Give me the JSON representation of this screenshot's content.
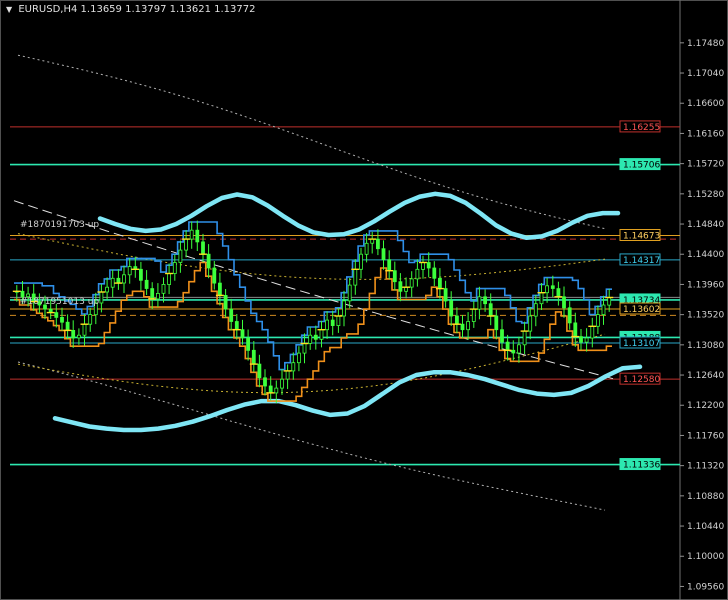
{
  "window": {
    "symbol": "EURUSD,H4",
    "ohlc": "1.13659 1.13797 1.13621 1.13772"
  },
  "objects": {
    "label_1": "#1870191703",
    "label_1_suffix": "up",
    "label_2": "#1871951013",
    "label_2_suffix": "up"
  },
  "chart_data": {
    "type": "candlestick",
    "symbol": "EURUSD",
    "timeframe": "H4",
    "ylim": [
      1.0945,
      1.179
    ],
    "y_ticks": [
      1.1748,
      1.1704,
      1.166,
      1.1616,
      1.1572,
      1.1528,
      1.1484,
      1.144,
      1.1396,
      1.1352,
      1.1308,
      1.1264,
      1.122,
      1.1176,
      1.1132,
      1.1088,
      1.1044,
      1.1,
      1.0956
    ],
    "y_tick_labels": [
      "1.17480",
      "1.17040",
      "1.16600",
      "1.16160",
      "1.15720",
      "1.15280",
      "1.14840",
      "1.14400",
      "1.13960",
      "1.13520",
      "1.13080",
      "1.12640",
      "1.12200",
      "1.11760",
      "1.11320",
      "1.10880",
      "1.10440",
      "1.10000",
      "1.09560"
    ],
    "horizontal_levels": [
      {
        "price": 1.16255,
        "label": "1.16255",
        "color": "#c0302c",
        "label_bg": "#000000",
        "label_border": "#c0302c",
        "label_color": "#ff5555"
      },
      {
        "price": 1.15706,
        "label": "1.15706",
        "color": "#2de8b0",
        "label_bg": "#2de8b0",
        "label_color": "#000000"
      },
      {
        "price": 1.14673,
        "label": "1.14673",
        "color": "#e0a020",
        "label_bg": "#000000",
        "label_border": "#e0a020",
        "label_color": "#ffd060"
      },
      {
        "price": 1.14317,
        "label": "1.14317",
        "color": "#2aa8c8",
        "label_bg": "#000000",
        "label_border": "#2aa8c8",
        "label_color": "#40d0f0"
      },
      {
        "price": 1.13772,
        "label": "1.13772",
        "color": "#8a8a8a",
        "label_bg": "#000000",
        "label_color": "#9a9a9a"
      },
      {
        "price": 1.13734,
        "label": "1.13734",
        "color": "#2de8b0",
        "label_bg": "#2de8b0",
        "label_color": "#000000"
      },
      {
        "price": 1.13602,
        "label": "1.13602",
        "color": "#e0a020",
        "label_bg": "#000000",
        "label_border": "#e0a020",
        "label_color": "#ffd060"
      },
      {
        "price": 1.13188,
        "label": "1.13188",
        "color": "#2de8b0",
        "label_bg": "#2de8b0",
        "label_color": "#000000"
      },
      {
        "price": 1.13107,
        "label": "1.13107",
        "color": "#2aa8c8",
        "label_bg": "#000000",
        "label_border": "#2aa8c8",
        "label_color": "#40d0f0"
      },
      {
        "price": 1.1258,
        "label": "1.12580",
        "color": "#c0302c",
        "label_bg": "#000000",
        "label_border": "#c0302c",
        "label_color": "#ff5555"
      },
      {
        "price": 1.11336,
        "label": "1.11336",
        "color": "#2de8b0",
        "label_bg": "#2de8b0",
        "label_color": "#000000"
      }
    ],
    "dashed_levels": [
      {
        "price": 1.1462,
        "color": "#c0302c"
      },
      {
        "price": 1.1351,
        "color": "#d08a20"
      }
    ],
    "close_series": [
      1.1386,
      1.1378,
      1.1382,
      1.1371,
      1.1366,
      1.136,
      1.1355,
      1.1348,
      1.1341,
      1.1329,
      1.1318,
      1.1322,
      1.1338,
      1.1352,
      1.1369,
      1.1385,
      1.1392,
      1.1405,
      1.1398,
      1.141,
      1.1422,
      1.1418,
      1.1402,
      1.139,
      1.1375,
      1.1383,
      1.1396,
      1.1412,
      1.1428,
      1.1446,
      1.1462,
      1.1475,
      1.1458,
      1.144,
      1.142,
      1.1398,
      1.138,
      1.136,
      1.1342,
      1.133,
      1.1318,
      1.13,
      1.128,
      1.126,
      1.1248,
      1.1238,
      1.1245,
      1.1258,
      1.127,
      1.1282,
      1.1296,
      1.131,
      1.1322,
      1.1316,
      1.133,
      1.1344,
      1.1336,
      1.135,
      1.1372,
      1.1395,
      1.1418,
      1.144,
      1.1456,
      1.1462,
      1.1448,
      1.1432,
      1.1416,
      1.14,
      1.1386,
      1.1392,
      1.1404,
      1.1418,
      1.1428,
      1.142,
      1.1405,
      1.139,
      1.1372,
      1.135,
      1.1338,
      1.133,
      1.1342,
      1.136,
      1.1378,
      1.1368,
      1.135,
      1.133,
      1.1312,
      1.13,
      1.1296,
      1.1308,
      1.1328,
      1.135,
      1.1368,
      1.1384,
      1.1394,
      1.139,
      1.1378,
      1.1362,
      1.134,
      1.132,
      1.1312,
      1.1318,
      1.1335,
      1.1352,
      1.1366,
      1.1377
    ],
    "upper_envelope": [
      1.1492,
      1.1484,
      1.1477,
      1.1474,
      1.1476,
      1.1484,
      1.1496,
      1.151,
      1.1522,
      1.1527,
      1.1523,
      1.1511,
      1.1496,
      1.1482,
      1.1472,
      1.1468,
      1.1469,
      1.1476,
      1.1488,
      1.1502,
      1.1515,
      1.1524,
      1.1528,
      1.1525,
      1.1515,
      1.1499,
      1.1482,
      1.147,
      1.1464,
      1.1466,
      1.1474,
      1.1486,
      1.1496,
      1.15,
      1.15
    ],
    "lower_envelope": [
      1.1201,
      1.1195,
      1.1189,
      1.1186,
      1.1184,
      1.1184,
      1.1186,
      1.119,
      1.1196,
      1.1204,
      1.1213,
      1.1221,
      1.1226,
      1.1226,
      1.122,
      1.1212,
      1.1206,
      1.1208,
      1.1219,
      1.1236,
      1.1253,
      1.1264,
      1.1268,
      1.1268,
      1.1264,
      1.1258,
      1.125,
      1.1242,
      1.1237,
      1.1235,
      1.1238,
      1.1248,
      1.1262,
      1.1274,
      1.1276
    ]
  }
}
